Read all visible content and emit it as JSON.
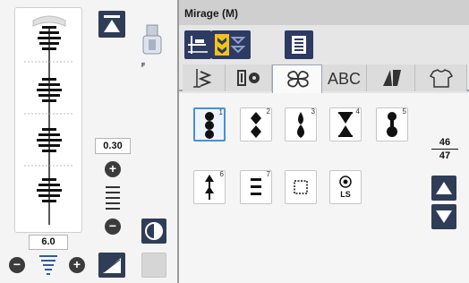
{
  "window": {
    "title": "Mirage (M)"
  },
  "left_panel": {
    "presser_foot_label": "F",
    "stitch_length": "0.30",
    "stitch_width": "6.0",
    "length_plus": "+",
    "length_minus": "−",
    "width_plus": "+",
    "width_minus": "−"
  },
  "tabs": [
    {
      "name": "utility-stitches",
      "icon": "needle-stitch-icon",
      "active": false
    },
    {
      "name": "buttonholes",
      "icon": "buttonhole-icon",
      "active": false
    },
    {
      "name": "decorative-stitches",
      "icon": "decorative-stitch-icon",
      "active": true
    },
    {
      "name": "alphabets",
      "label": "ABC",
      "active": false
    },
    {
      "name": "quilt-stitches",
      "icon": "quilt-icon",
      "active": false
    },
    {
      "name": "garment-stitches",
      "icon": "shirt-icon",
      "active": false
    }
  ],
  "patterns": [
    {
      "number": "1",
      "selected": true
    },
    {
      "number": "2",
      "selected": false
    },
    {
      "number": "3",
      "selected": false
    },
    {
      "number": "4",
      "selected": false
    },
    {
      "number": "5",
      "selected": false
    },
    {
      "number": "6",
      "selected": false
    },
    {
      "number": "7",
      "selected": false
    },
    {
      "number": "",
      "selected": false
    },
    {
      "number": "",
      "selected": false,
      "label": "LS"
    }
  ],
  "pagination": {
    "current": "46",
    "total": "47"
  },
  "colors": {
    "accent": "#2f3d57",
    "selection": "#4a8fd6",
    "highlight": "#f2c21b"
  }
}
